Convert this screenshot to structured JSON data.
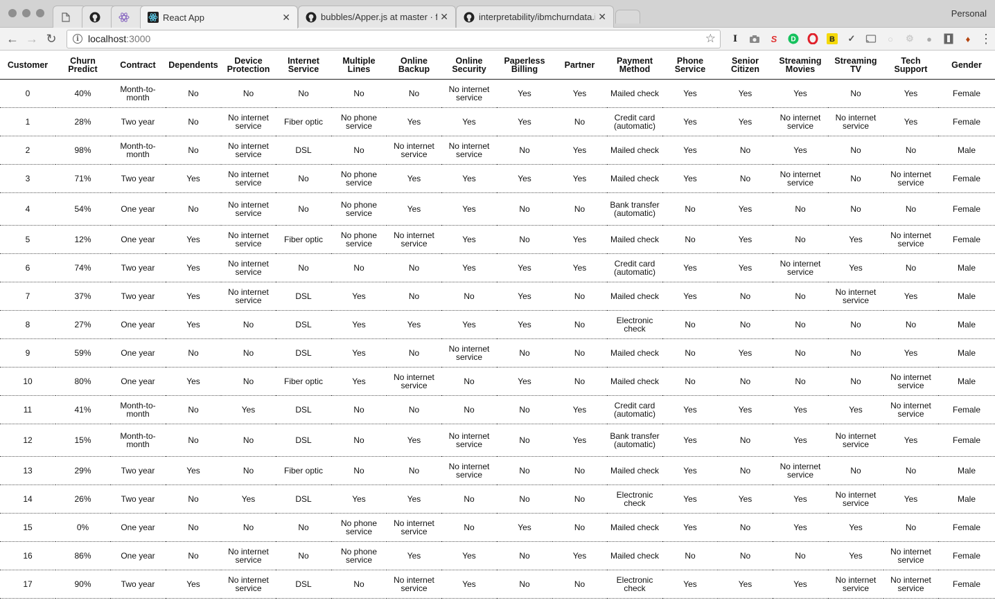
{
  "browser": {
    "tabs": [
      {
        "title": "",
        "icon": "page-icon"
      },
      {
        "title": "",
        "icon": "github-icon"
      },
      {
        "title": "",
        "icon": "atom-icon"
      },
      {
        "title": "React App",
        "icon": "react-icon",
        "active": true
      },
      {
        "title": "bubbles/Apper.js at master · fa",
        "icon": "github-icon"
      },
      {
        "title": "interpretability/ibmchurndata.i",
        "icon": "github-icon"
      }
    ],
    "profile": "Personal",
    "url_host": "localhost",
    "url_port": ":3000"
  },
  "table": {
    "headers": [
      "Customer",
      "Churn Predict",
      "Contract",
      "Dependents",
      "Device Protection",
      "Internet Service",
      "Multiple Lines",
      "Online Backup",
      "Online Security",
      "Paperless Billing",
      "Partner",
      "Payment Method",
      "Phone Service",
      "Senior Citizen",
      "Streaming Movies",
      "Streaming TV",
      "Tech Support",
      "Gender"
    ],
    "rows": [
      [
        "0",
        "40%",
        "Month-to-month",
        "No",
        "No",
        "No",
        "No",
        "No",
        "No internet service",
        "Yes",
        "Yes",
        "Mailed check",
        "Yes",
        "Yes",
        "Yes",
        "No",
        "Yes",
        "Female"
      ],
      [
        "1",
        "28%",
        "Two year",
        "No",
        "No internet service",
        "Fiber optic",
        "No phone service",
        "Yes",
        "Yes",
        "Yes",
        "No",
        "Credit card (automatic)",
        "Yes",
        "Yes",
        "No internet service",
        "No internet service",
        "Yes",
        "Female"
      ],
      [
        "2",
        "98%",
        "Month-to-month",
        "No",
        "No internet service",
        "DSL",
        "No",
        "No internet service",
        "No internet service",
        "No",
        "Yes",
        "Mailed check",
        "Yes",
        "No",
        "Yes",
        "No",
        "No",
        "Male"
      ],
      [
        "3",
        "71%",
        "Two year",
        "Yes",
        "No internet service",
        "No",
        "No phone service",
        "Yes",
        "Yes",
        "Yes",
        "Yes",
        "Mailed check",
        "Yes",
        "No",
        "No internet service",
        "No",
        "No internet service",
        "Female"
      ],
      [
        "4",
        "54%",
        "One year",
        "No",
        "No internet service",
        "No",
        "No phone service",
        "Yes",
        "Yes",
        "No",
        "No",
        "Bank transfer (automatic)",
        "No",
        "Yes",
        "No",
        "No",
        "No",
        "Female"
      ],
      [
        "5",
        "12%",
        "One year",
        "Yes",
        "No internet service",
        "Fiber optic",
        "No phone service",
        "No internet service",
        "Yes",
        "No",
        "Yes",
        "Mailed check",
        "No",
        "Yes",
        "No",
        "Yes",
        "No internet service",
        "Female"
      ],
      [
        "6",
        "74%",
        "Two year",
        "Yes",
        "No internet service",
        "No",
        "No",
        "No",
        "Yes",
        "Yes",
        "Yes",
        "Credit card (automatic)",
        "Yes",
        "Yes",
        "No internet service",
        "Yes",
        "No",
        "Male"
      ],
      [
        "7",
        "37%",
        "Two year",
        "Yes",
        "No internet service",
        "DSL",
        "Yes",
        "No",
        "No",
        "Yes",
        "No",
        "Mailed check",
        "Yes",
        "No",
        "No",
        "No internet service",
        "Yes",
        "Male"
      ],
      [
        "8",
        "27%",
        "One year",
        "Yes",
        "No",
        "DSL",
        "Yes",
        "Yes",
        "Yes",
        "Yes",
        "No",
        "Electronic check",
        "No",
        "No",
        "No",
        "No",
        "No",
        "Male"
      ],
      [
        "9",
        "59%",
        "One year",
        "No",
        "No",
        "DSL",
        "Yes",
        "No",
        "No internet service",
        "No",
        "No",
        "Mailed check",
        "No",
        "Yes",
        "No",
        "No",
        "Yes",
        "Male"
      ],
      [
        "10",
        "80%",
        "One year",
        "Yes",
        "No",
        "Fiber optic",
        "Yes",
        "No internet service",
        "No",
        "Yes",
        "No",
        "Mailed check",
        "No",
        "No",
        "No",
        "No",
        "No internet service",
        "Male"
      ],
      [
        "11",
        "41%",
        "Month-to-month",
        "No",
        "Yes",
        "DSL",
        "No",
        "No",
        "No",
        "No",
        "Yes",
        "Credit card (automatic)",
        "Yes",
        "Yes",
        "Yes",
        "Yes",
        "No internet service",
        "Female"
      ],
      [
        "12",
        "15%",
        "Month-to-month",
        "No",
        "No",
        "DSL",
        "No",
        "Yes",
        "No internet service",
        "No",
        "Yes",
        "Bank transfer (automatic)",
        "Yes",
        "No",
        "Yes",
        "No internet service",
        "Yes",
        "Female"
      ],
      [
        "13",
        "29%",
        "Two year",
        "Yes",
        "No",
        "Fiber optic",
        "No",
        "No",
        "No internet service",
        "No",
        "No",
        "Mailed check",
        "Yes",
        "No",
        "No internet service",
        "No",
        "No",
        "Male"
      ],
      [
        "14",
        "26%",
        "Two year",
        "No",
        "Yes",
        "DSL",
        "Yes",
        "Yes",
        "No",
        "No",
        "No",
        "Electronic check",
        "Yes",
        "Yes",
        "Yes",
        "No internet service",
        "Yes",
        "Male"
      ],
      [
        "15",
        "0%",
        "One year",
        "No",
        "No",
        "No",
        "No phone service",
        "No internet service",
        "No",
        "Yes",
        "No",
        "Mailed check",
        "Yes",
        "No",
        "Yes",
        "Yes",
        "No",
        "Female"
      ],
      [
        "16",
        "86%",
        "One year",
        "No",
        "No internet service",
        "No",
        "No phone service",
        "Yes",
        "Yes",
        "No",
        "Yes",
        "Mailed check",
        "No",
        "No",
        "No",
        "Yes",
        "No internet service",
        "Female"
      ],
      [
        "17",
        "90%",
        "Two year",
        "Yes",
        "No internet service",
        "DSL",
        "No",
        "No internet service",
        "Yes",
        "No",
        "No",
        "Electronic check",
        "Yes",
        "Yes",
        "Yes",
        "No internet service",
        "No internet service",
        "Female"
      ]
    ]
  }
}
